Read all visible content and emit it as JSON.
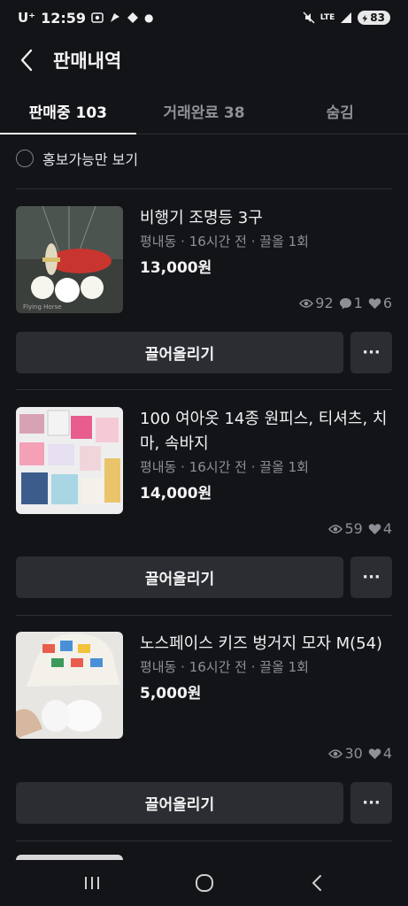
{
  "status_bar": {
    "carrier": "U⁺",
    "time": "12:59",
    "battery": "83"
  },
  "header": {
    "title": "판매내역"
  },
  "tabs": [
    {
      "label": "판매중 103",
      "active": true
    },
    {
      "label": "거래완료 38",
      "active": false
    },
    {
      "label": "숨김",
      "active": false
    }
  ],
  "filter": {
    "label": "홍보가능만 보기"
  },
  "items": [
    {
      "title": "비행기 조명등 3구",
      "meta": "평내동 · 16시간 전 · 끌올 1회",
      "price": "13,000원",
      "views": "92",
      "chats": "1",
      "likes": "6",
      "thumb_text": "Flying Horse",
      "bump_label": "끌어올리기",
      "more_label": "···"
    },
    {
      "title": "100 여아옷 14종 원피스, 티셔츠, 치마, 속바지",
      "meta": "평내동 · 16시간 전 · 끌올 1회",
      "price": "14,000원",
      "views": "59",
      "likes": "4",
      "bump_label": "끌어올리기",
      "more_label": "···"
    },
    {
      "title": "노스페이스 키즈 벙거지 모자 M(54)",
      "meta": "평내동 · 16시간 전 · 끌올 1회",
      "price": "5,000원",
      "views": "30",
      "likes": "4",
      "bump_label": "끌어올리기",
      "more_label": "···"
    }
  ],
  "colors": {
    "background": "#131418",
    "button": "#2b2d32",
    "muted_text": "#8d9097"
  }
}
